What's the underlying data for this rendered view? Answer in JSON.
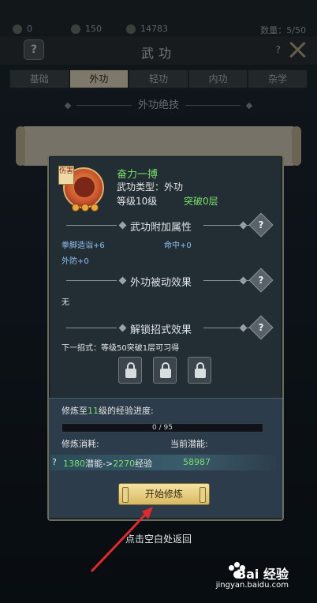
{
  "resources": [
    {
      "name": "jade",
      "icon": "jade-icon",
      "value": "0"
    },
    {
      "name": "ingot",
      "icon": "ingot-icon",
      "value": "150"
    },
    {
      "name": "coin",
      "icon": "coin-icon",
      "value": "14783"
    }
  ],
  "count_text": "数量：5/50",
  "title": "武功",
  "help_label": "?",
  "tabs": [
    {
      "label": "基础",
      "active": false
    },
    {
      "label": "外功",
      "active": true
    },
    {
      "label": "轻功",
      "active": false
    },
    {
      "label": "内功",
      "active": false
    },
    {
      "label": "杂学",
      "active": false
    }
  ],
  "section_title": "外功绝技",
  "behind_card": {
    "tag": "伤害",
    "name": "奋力一搏"
  },
  "popup": {
    "type_tag": "伤害",
    "skill_name": "奋力一搏",
    "skill_type": "武功类型：外功",
    "level": "等级10级",
    "breakthrough": "突破0层",
    "attr_title": "武功附加属性",
    "attrs": {
      "fist": "拳脚造诣+6",
      "hit": "命中+0",
      "defense": "外防+0"
    },
    "passive_title": "外功被动效果",
    "passive_value": "无",
    "unlock_title": "解锁招式效果",
    "next_move": "下一招式：等级50突破1层可习得",
    "progress": {
      "label_prefix": "修炼至",
      "target_level": "11",
      "label_suffix": "级的经验进度:",
      "current": 0,
      "max": 95,
      "text": "0 / 95"
    },
    "cost_label": "修炼消耗:",
    "potential_label": "当前潜能:",
    "cost_question": "?",
    "cost_potential": "1380",
    "cost_middle": "潜能->",
    "cost_exp": "2270",
    "cost_exp_suffix": "经验",
    "current_potential": "58987",
    "train_button": "开始修炼"
  },
  "hint": "点击空白处返回",
  "watermark": {
    "brand": "Bai 经验",
    "url": "jingyan.baidu.com"
  },
  "colors": {
    "green": "#7ae06b",
    "blue_attr": "#8ec0f0",
    "gold": "#d9b962",
    "active_tab": "#e6dcc4"
  }
}
